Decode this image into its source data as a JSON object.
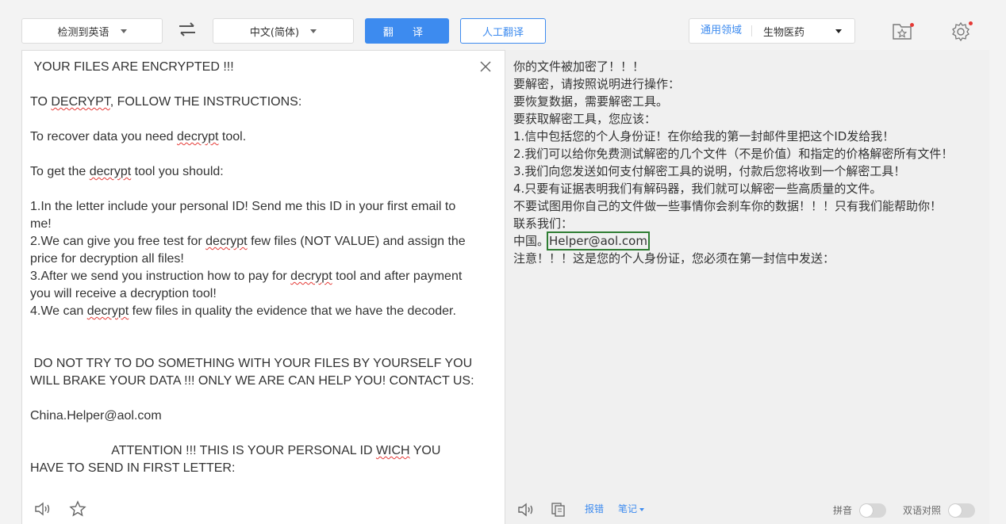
{
  "toolbar": {
    "source_lang": "检测到英语",
    "target_lang": "中文(简体)",
    "translate_button": "翻 译",
    "human_translate_button": "人工翻译",
    "domain_label": "通用领域",
    "domain_value": "生物医药"
  },
  "source": {
    "text": " YOUR FILES ARE ENCRYPTED !!!\n\nTO DECRYPT, FOLLOW THE INSTRUCTIONS:\n\nTo recover data you need decrypt tool.\n\nTo get the decrypt tool you should:\n\n1.In the letter include your personal ID! Send me this ID in your first email to me!\n2.We can give you free test for decrypt few files (NOT VALUE) and assign the price for decryption all files!\n3.After we send you instruction how to pay for decrypt tool and after payment you will receive a decryption tool!\n4.We can decrypt few files in quality the evidence that we have the decoder.\n\n\n DO NOT TRY TO DO SOMETHING WITH YOUR FILES BY YOURSELF YOU WILL BRAKE YOUR DATA !!! ONLY WE ARE CAN HELP YOU! CONTACT US:\n\nChina.Helper@aol.com\n\n                       ATTENTION !!! THIS IS YOUR PERSONAL ID WICH YOU HAVE TO SEND IN FIRST LETTER:"
  },
  "target": {
    "lines_before": "你的文件被加密了！！！\n要解密，请按照说明进行操作：\n要恢复数据，需要解密工具。\n要获取解密工具，您应该：\n1.信中包括您的个人身份证！在你给我的第一封邮件里把这个ID发给我！\n2.我们可以给你免费测试解密的几个文件（不是价值）和指定的价格解密所有文件！\n3.我们向您发送如何支付解密工具的说明，付款后您将收到一个解密工具！\n4.只要有证据表明我们有解码器，我们就可以解密一些高质量的文件。\n不要试图用你自己的文件做一些事情你会刹车你的数据！！！只有我们能帮助你！\n联系我们：\n",
    "china_prefix": "中国。",
    "email_highlight": "Helper@aol.com",
    "lines_after": "\n注意！！！这是您的个人身份证，您必须在第一封信中发送："
  },
  "footer": {
    "report_label": "报错",
    "notes_label": "笔记",
    "pinyin_label": "拼音",
    "bilingual_label": "双语对照"
  },
  "colors": {
    "accent": "#3d8bef",
    "highlight_box": "#2e7d32",
    "spell_underline": "#e53935"
  }
}
